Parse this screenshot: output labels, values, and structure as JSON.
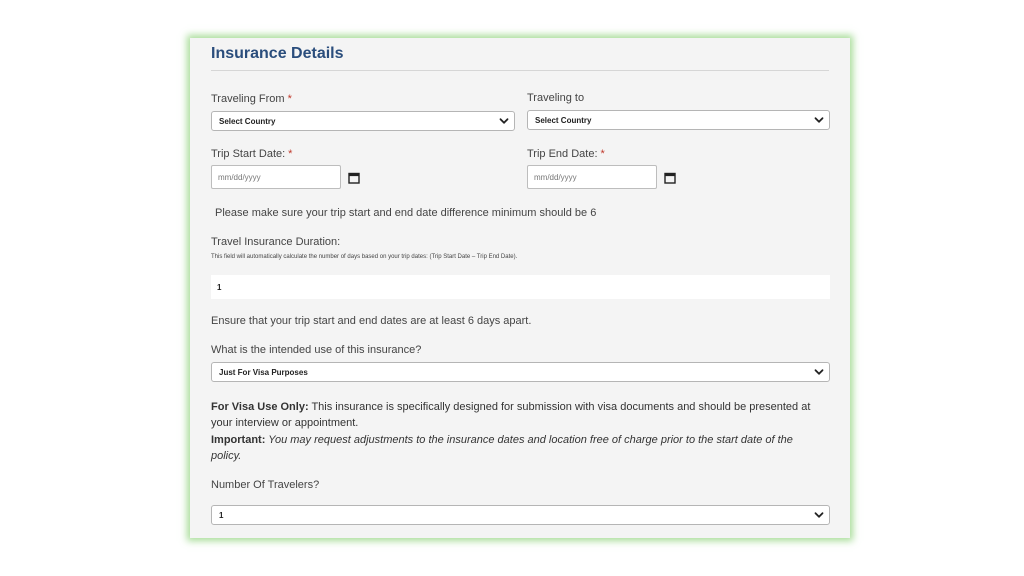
{
  "form": {
    "title": "Insurance Details",
    "required_mark": "*",
    "traveling_from": {
      "label": "Traveling From",
      "value": "Select Country"
    },
    "traveling_to": {
      "label": "Traveling to",
      "value": "Select Country"
    },
    "trip_start": {
      "label": "Trip Start Date:",
      "placeholder": "mm/dd/yyyy"
    },
    "trip_end": {
      "label": "Trip End Date:",
      "placeholder": "mm/dd/yyyy"
    },
    "date_note": "Please make sure your trip start and end date difference minimum should be 6",
    "duration": {
      "label": "Travel Insurance Duration:",
      "help": "This field will automatically calculate the number of days based on your trip dates: (Trip Start Date – Trip End Date).",
      "value": "1"
    },
    "apart_note": "Ensure that your trip start and end dates are at least 6 days apart.",
    "intended_use": {
      "label": "What is the intended use of this insurance?",
      "value": "Just For Visa Purposes"
    },
    "visa_info": {
      "lead_bold": "For Visa Use Only:",
      "lead_text": " This insurance is specifically designed for submission with visa documents and should be presented at your interview or appointment.",
      "important_bold": "Important:",
      "important_text": " You may request adjustments to the insurance dates and location free of charge prior to the start date of the policy."
    },
    "travelers": {
      "label": "Number Of Travelers?",
      "value": "1"
    }
  },
  "icons": {
    "dropdown": "chevron-down-icon",
    "date": "calendar-icon"
  },
  "colors": {
    "title": "#2a4d7c",
    "required": "#c0392b",
    "card_glow": "#8cd278",
    "card_bg": "#f4f4f4"
  }
}
